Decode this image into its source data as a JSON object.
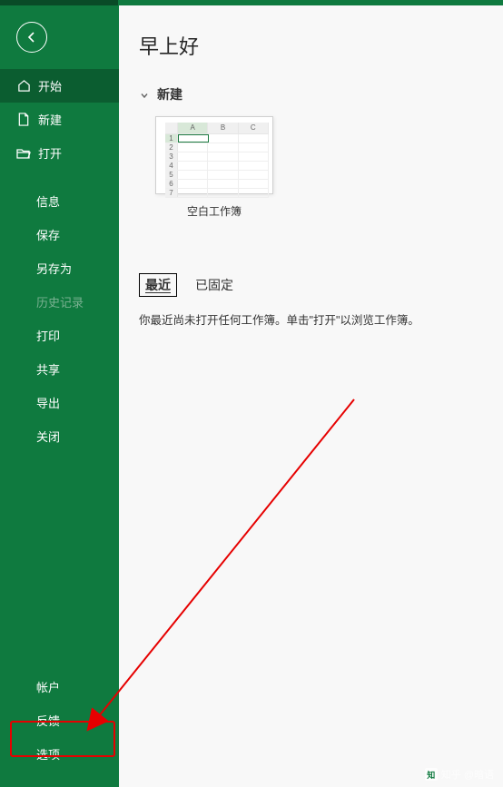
{
  "greeting": "早上好",
  "sidebar": {
    "back": "返回",
    "top": [
      {
        "label": "开始",
        "icon": "home-icon",
        "active": true
      },
      {
        "label": "新建",
        "icon": "file-icon",
        "active": false
      },
      {
        "label": "打开",
        "icon": "folder-open-icon",
        "active": false
      }
    ],
    "mid": [
      {
        "label": "信息",
        "disabled": false
      },
      {
        "label": "保存",
        "disabled": false
      },
      {
        "label": "另存为",
        "disabled": false
      },
      {
        "label": "历史记录",
        "disabled": true
      },
      {
        "label": "打印",
        "disabled": false
      },
      {
        "label": "共享",
        "disabled": false
      },
      {
        "label": "导出",
        "disabled": false
      },
      {
        "label": "关闭",
        "disabled": false
      }
    ],
    "bottom": [
      {
        "label": "帐户"
      },
      {
        "label": "反馈"
      },
      {
        "label": "选项"
      }
    ]
  },
  "section_new": {
    "title": "新建",
    "template_label": "空白工作簿",
    "cols": [
      "A",
      "B",
      "C"
    ],
    "rows": [
      "1",
      "2",
      "3",
      "4",
      "5",
      "6",
      "7"
    ]
  },
  "tabs": {
    "recent": "最近",
    "pinned": "已固定"
  },
  "recent_message": "你最近尚未打开任何工作簿。单击\"打开\"以浏览工作簿。",
  "watermark": "知乎 @暗语",
  "watermark_icon": "知",
  "colors": {
    "brand_green": "#0f7a3f",
    "brand_green_dark": "#0b5d30",
    "annotation_red": "#e60000"
  }
}
